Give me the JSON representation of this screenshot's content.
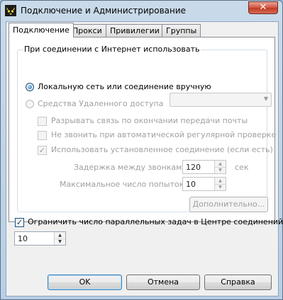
{
  "window": {
    "title": "Подключение и Администрирование",
    "close_label": "✕",
    "app_icon": "cat-app-icon"
  },
  "tabs": [
    {
      "label": "Подключение",
      "active": true
    },
    {
      "label": "Прокси",
      "active": false
    },
    {
      "label": "Привилегии",
      "active": false
    },
    {
      "label": "Группы",
      "active": false
    }
  ],
  "group": {
    "title": "При соединении с Интернет использовать",
    "radio_lan": {
      "label": "Локальную сеть или соединение вручную",
      "checked": true
    },
    "radio_dialup": {
      "label": "Средства Удаленного доступа",
      "checked": false,
      "enabled": false
    },
    "dialup_connection": {
      "value": ""
    },
    "cb_hangup": {
      "label": "Разрывать связь по окончании передачи почты",
      "checked": false
    },
    "cb_nodial": {
      "label": "Не звонить при автоматической регулярной проверке",
      "checked": false
    },
    "cb_existing": {
      "label": "Использовать установленное соединение (если есть)",
      "checked": true
    },
    "delay": {
      "label": "Задержка между звонками:",
      "value": "120",
      "unit": "сек"
    },
    "attempts": {
      "label": "Максимальное число попыток:",
      "value": "10"
    },
    "advanced_button": "Дополнительно..."
  },
  "limit_tasks": {
    "label": "Ограничить число параллельных задач в Центре соединений",
    "checked": true,
    "value": "10"
  },
  "buttons": {
    "ok": "OK",
    "cancel": "Отмена",
    "help": "Справка"
  },
  "colors": {
    "titlebar": "#b8cfe5",
    "close_button": "#c9412a",
    "accent": "#1c5180"
  }
}
